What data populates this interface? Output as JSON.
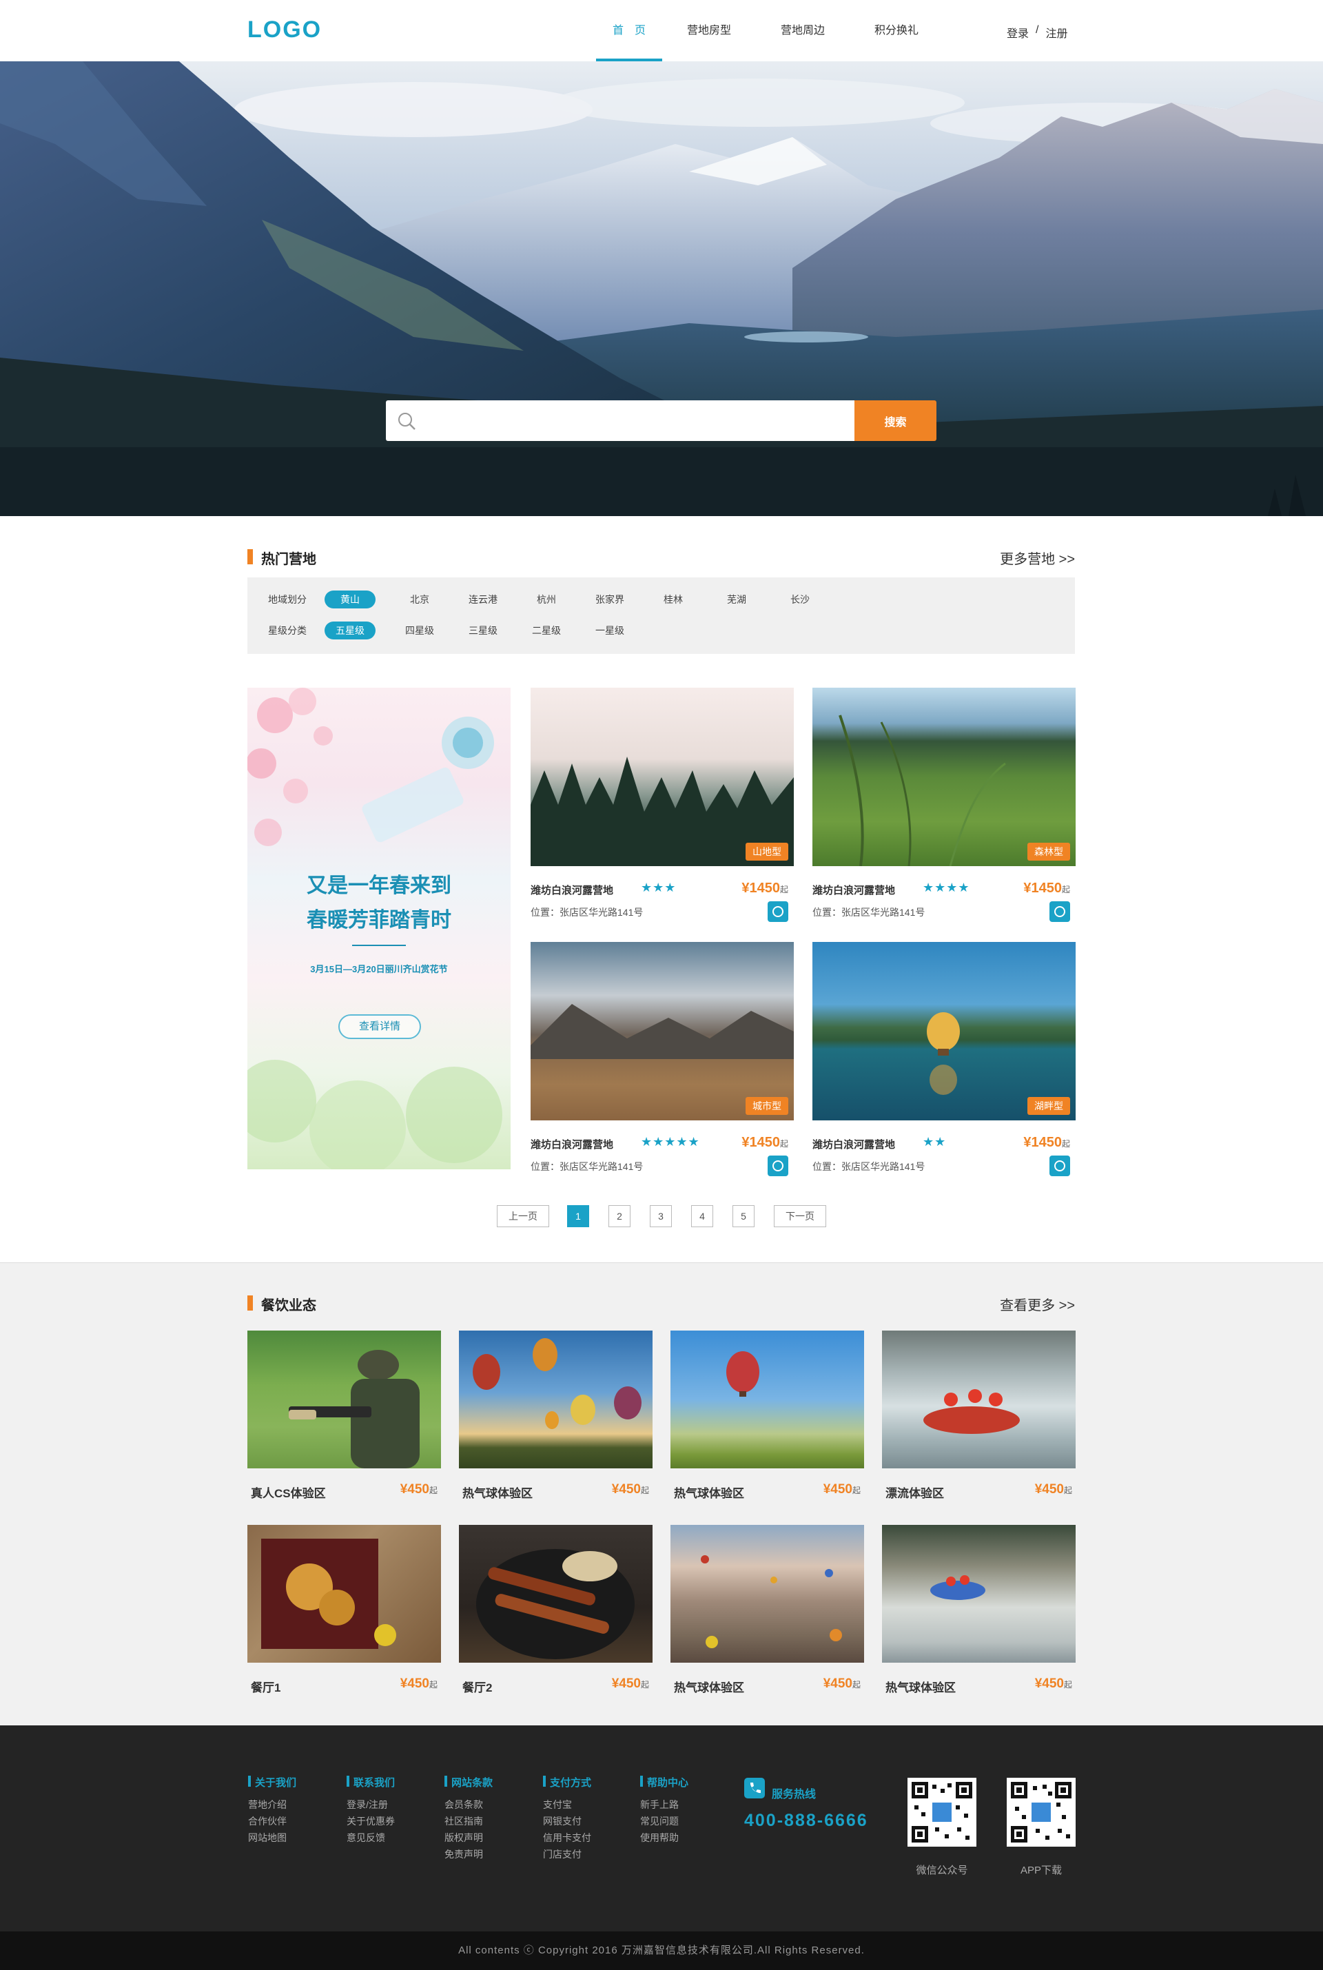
{
  "header": {
    "logo": "LOGO",
    "nav": [
      "首　页",
      "营地房型",
      "营地周边",
      "积分换礼"
    ],
    "login": "登录",
    "separator": "/",
    "register": "注册"
  },
  "search": {
    "placeholder": "",
    "button": "搜索"
  },
  "hot_camps": {
    "title": "热门营地",
    "more": "更多营地 >>",
    "region_label": "地域划分",
    "regions": [
      "黄山",
      "北京",
      "连云港",
      "杭州",
      "张家界",
      "桂林",
      "芜湖",
      "长沙"
    ],
    "star_label": "星级分类",
    "stars": [
      "五星级",
      "四星级",
      "三星级",
      "二星级",
      "一星级"
    ]
  },
  "promo": {
    "line1": "又是一年春来到",
    "line2": "春暖芳菲踏青时",
    "date": "3月15日—3月20日丽川齐山赏花节",
    "button": "查看详情"
  },
  "camps": [
    {
      "tag": "山地型",
      "title": "潍坊白浪河露营地",
      "stars": 3,
      "star_text": "★★★",
      "currency": "¥",
      "price": "1450",
      "unit": "起",
      "location": "位置：张店区华光路141号"
    },
    {
      "tag": "森林型",
      "title": "潍坊白浪河露营地",
      "stars": 4,
      "star_text": "★★★★",
      "currency": "¥",
      "price": "1450",
      "unit": "起",
      "location": "位置：张店区华光路141号"
    },
    {
      "tag": "城市型",
      "title": "潍坊白浪河露营地",
      "stars": 5,
      "star_text": "★★★★★",
      "currency": "¥",
      "price": "1450",
      "unit": "起",
      "location": "位置：张店区华光路141号"
    },
    {
      "tag": "湖畔型",
      "title": "潍坊白浪河露营地",
      "stars": 2,
      "star_text": "★★",
      "currency": "¥",
      "price": "1450",
      "unit": "起",
      "location": "位置：张店区华光路141号"
    }
  ],
  "pagination": {
    "prev": "上一页",
    "pages": [
      "1",
      "2",
      "3",
      "4",
      "5"
    ],
    "current": "1",
    "next": "下一页"
  },
  "food": {
    "title": "餐饮业态",
    "more": "查看更多 >>",
    "items": [
      {
        "name": "真人CS体验区",
        "price": "¥450",
        "unit": "起"
      },
      {
        "name": "热气球体验区",
        "price": "¥450",
        "unit": "起"
      },
      {
        "name": "热气球体验区",
        "price": "¥450",
        "unit": "起"
      },
      {
        "name": "漂流体验区",
        "price": "¥450",
        "unit": "起"
      },
      {
        "name": "餐厅1",
        "price": "¥450",
        "unit": "起"
      },
      {
        "name": "餐厅2",
        "price": "¥450",
        "unit": "起"
      },
      {
        "name": "热气球体验区",
        "price": "¥450",
        "unit": "起"
      },
      {
        "name": "热气球体验区",
        "price": "¥450",
        "unit": "起"
      }
    ]
  },
  "footer": {
    "columns": [
      {
        "title": "关于我们",
        "items": [
          "营地介绍",
          "合作伙伴",
          "网站地图"
        ]
      },
      {
        "title": "联系我们",
        "items": [
          "登录/注册",
          "关于优惠券",
          "意见反馈"
        ]
      },
      {
        "title": "网站条款",
        "items": [
          "会员条款",
          "社区指南",
          "版权声明",
          "免责声明"
        ]
      },
      {
        "title": "支付方式",
        "items": [
          "支付宝",
          "网银支付",
          "信用卡支付",
          "门店支付"
        ]
      },
      {
        "title": "帮助中心",
        "items": [
          "新手上路",
          "常见问题",
          "使用帮助"
        ]
      }
    ],
    "hotline_label": "服务热线",
    "hotline_number": "400-888-6666",
    "qr1_caption": "微信公众号",
    "qr2_caption": "APP下载",
    "copyright": "All contents ⓒ Copyright 2016 万洲嘉智信息技术有限公司.All Rights Reserved."
  },
  "colors": {
    "accent": "#1aa2c7",
    "orange": "#f08324",
    "footer_bg": "#242424"
  }
}
